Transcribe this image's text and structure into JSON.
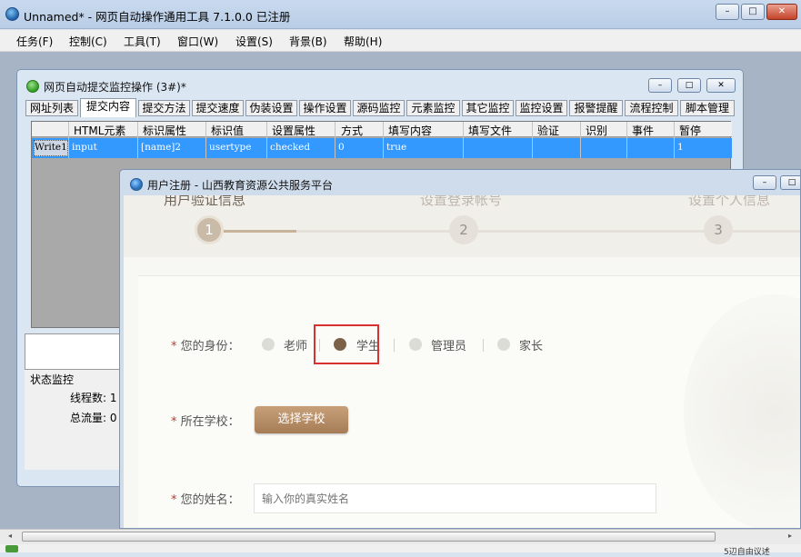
{
  "app": {
    "title": "Unnamed* - 网页自动操作通用工具 7.1.0.0  已注册",
    "window_buttons": {
      "minimize": "–",
      "maximize": "□",
      "close": "✕"
    }
  },
  "menu": [
    "任务(F)",
    "控制(C)",
    "工具(T)",
    "窗口(W)",
    "设置(S)",
    "背景(B)",
    "帮助(H)"
  ],
  "inner_window": {
    "title": "网页自动提交监控操作  (3#)*",
    "tabs": [
      "网址列表",
      "提交内容",
      "提交方法",
      "提交速度",
      "伪装设置",
      "操作设置",
      "源码监控",
      "元素监控",
      "其它监控",
      "监控设置",
      "报警提醒",
      "流程控制",
      "脚本管理"
    ],
    "active_tab": "提交内容",
    "grid": {
      "columns": [
        "HTML元素",
        "标识属性",
        "标识值",
        "设置属性",
        "方式",
        "填写内容",
        "填写文件",
        "验证",
        "识别",
        "事件",
        "暂停"
      ],
      "rows": [
        {
          "row_label": "Write1",
          "cells": [
            "input",
            "[name]2",
            "usertype",
            "checked",
            "0",
            "true",
            "",
            "",
            "",
            "",
            "1"
          ]
        }
      ]
    },
    "status": {
      "heading": "状态监控",
      "threads_label": "线程数: 1",
      "traffic_label": "总流量: 0"
    }
  },
  "browser_window": {
    "title": "用户注册 - 山西教育资源公共服务平台",
    "steps": [
      {
        "number": "1",
        "label": "用户验证信息",
        "done": true
      },
      {
        "number": "2",
        "label": "设置登录帐号",
        "done": false
      },
      {
        "number": "3",
        "label": "设置个人信息",
        "done": false
      }
    ],
    "form": {
      "required_mark": "*",
      "identity_label": "您的身份：",
      "identity_options": [
        {
          "label": "老师",
          "selected": false
        },
        {
          "label": "学生",
          "selected": true
        },
        {
          "label": "管理员",
          "selected": false
        },
        {
          "label": "家长",
          "selected": false
        }
      ],
      "school_label": "所在学校：",
      "school_button": "选择学校",
      "name_label": "您的姓名：",
      "name_placeholder": "输入你的真实姓名",
      "name_value": ""
    }
  },
  "statusbar": {
    "text": "5辺自由议述"
  },
  "colors": {
    "accent_blue": "#3399ff",
    "selected_radio": "#7a6148",
    "button_brown": "#b08a64",
    "highlight_red": "#d93030"
  }
}
